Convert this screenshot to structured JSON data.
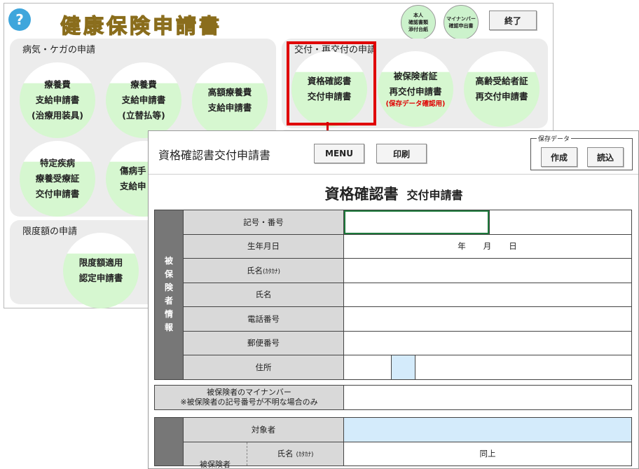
{
  "menu": {
    "help_icon": "?",
    "title": "健康保険申請書",
    "small_buttons": [
      {
        "lines": [
          "本人",
          "確認書類",
          "添付台紙"
        ]
      },
      {
        "lines": [
          "マイナンバー",
          "確認申出書"
        ]
      }
    ],
    "end_label": "終了",
    "sections": [
      {
        "title": "病気・ケガの申請",
        "items": [
          {
            "lines": [
              "療養費",
              "支給申請書",
              "(治療用装具)"
            ]
          },
          {
            "lines": [
              "療養費",
              "支給申請書",
              "(立替払等)"
            ]
          },
          {
            "lines": [
              "高額療養費",
              "支給申請書"
            ]
          },
          {
            "lines": [
              "特定疾病",
              "療養受療証",
              "交付申請書"
            ]
          },
          {
            "lines": [
              "傷病手",
              "支給申"
            ]
          }
        ]
      },
      {
        "title": "交付・再交付の申請",
        "items": [
          {
            "lines": [
              "資格確認書",
              "交付申請書"
            ]
          },
          {
            "lines": [
              "被保険者証",
              "再交付申請書"
            ],
            "note": "(保存データ確認用)"
          },
          {
            "lines": [
              "高齢受給者証",
              "再交付申請書"
            ]
          }
        ]
      },
      {
        "title": "限度額の申請",
        "items": [
          {
            "lines": [
              "限度額適用",
              "認定申請書"
            ]
          }
        ]
      }
    ]
  },
  "form": {
    "window_title": "資格確認書交付申請書",
    "menu_label": "MENU",
    "print_label": "印刷",
    "save_group_label": "保存データ",
    "create_label": "作成",
    "load_label": "読込",
    "heading_main": "資格確認書",
    "heading_sub": "交付申請書",
    "insured_section_label": [
      "被",
      "保",
      "険",
      "者",
      "情",
      "報"
    ],
    "rows": [
      {
        "label": "記号・番号"
      },
      {
        "label": "生年月日",
        "value_parts": [
          "年",
          "月",
          "日"
        ]
      },
      {
        "label": "氏名",
        "kana": "(ｶﾀｶﾅ)"
      },
      {
        "label": "氏名"
      },
      {
        "label": "電話番号"
      },
      {
        "label": "郵便番号"
      },
      {
        "label": "住所"
      }
    ],
    "mynumber_label_line1": "被保険者のマイナンバー",
    "mynumber_label_line2": "※被保険者の記号番号が不明な場合のみ",
    "target_label": "対象者",
    "target_name_label": "氏名",
    "target_name_kana": "(ｶﾀｶﾅ)",
    "target_name_value": "同上",
    "target_insured_label": "被保険者"
  }
}
